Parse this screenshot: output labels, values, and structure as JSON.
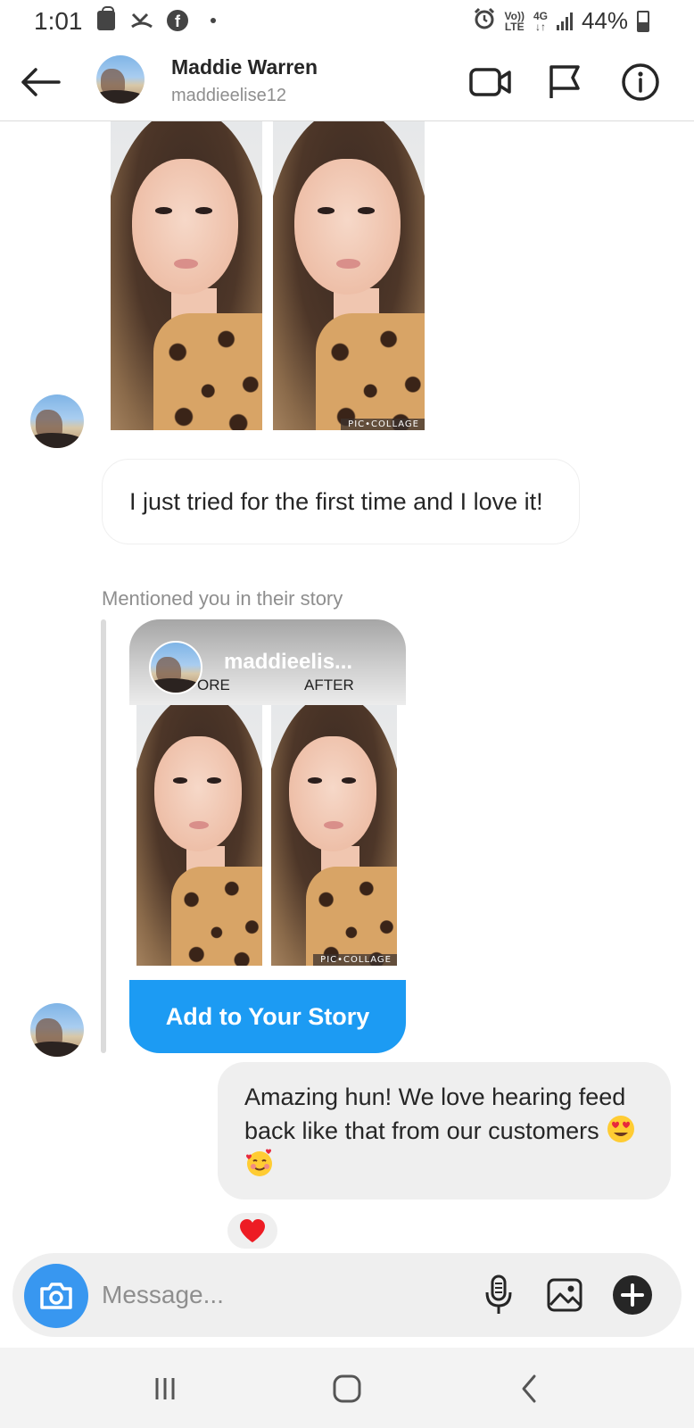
{
  "status_bar": {
    "time": "1:01",
    "volte_top": "Vo))",
    "volte_bottom": "LTE",
    "network_top": "4G",
    "network_bottom": "↓↑",
    "battery": "44%"
  },
  "header": {
    "name": "Maddie Warren",
    "username": "maddieelise12",
    "icons": [
      "back-arrow-icon",
      "video-call-icon",
      "flag-icon",
      "info-icon"
    ]
  },
  "messages": {
    "photo_watermark": "PIC•COLLAGE",
    "incoming_text": "I just tried for the first time and I love it!",
    "mention_label": "Mentioned you in their story",
    "story": {
      "username": "maddieelis...",
      "before_label": "ORE",
      "after_label": "AFTER",
      "watermark": "PIC•COLLAGE",
      "add_button": "Add to Your Story"
    },
    "outgoing_text": "Amazing hun! We love hearing feed back like that from our customers",
    "outgoing_emojis": [
      "heart-eyes-emoji",
      "smiling-face-with-hearts-emoji"
    ],
    "reaction": "heart-reaction-icon",
    "reaction_color": "#ed1c24"
  },
  "composer": {
    "placeholder": "Message...",
    "camera_color": "#3897f0",
    "icons": [
      "camera-icon",
      "microphone-icon",
      "gallery-icon",
      "plus-icon"
    ]
  },
  "nav_bar": {
    "icons": [
      "recents-icon",
      "home-icon",
      "back-icon"
    ]
  },
  "colors": {
    "accent_blue": "#1c9bf3",
    "secondary_text": "#8e8e8e",
    "bubble_gray": "#efefef"
  }
}
